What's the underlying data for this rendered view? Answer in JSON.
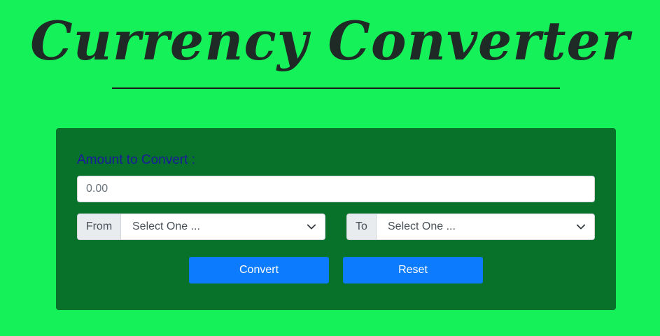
{
  "page": {
    "title": "Currency Converter"
  },
  "form": {
    "amount_label": "Amount to Convert :",
    "amount_placeholder": "0.00",
    "from_label": "From",
    "from_selected": "Select One ...",
    "to_label": "To",
    "to_selected": "Select One ...",
    "convert_label": "Convert",
    "reset_label": "Reset"
  },
  "icons": {
    "select_arrow": "chevron-down-icon"
  },
  "colors": {
    "page_background": "#15f159",
    "panel_background": "#08722b",
    "button_background": "#0d7bfd",
    "label_color": "#1a1a9c"
  }
}
